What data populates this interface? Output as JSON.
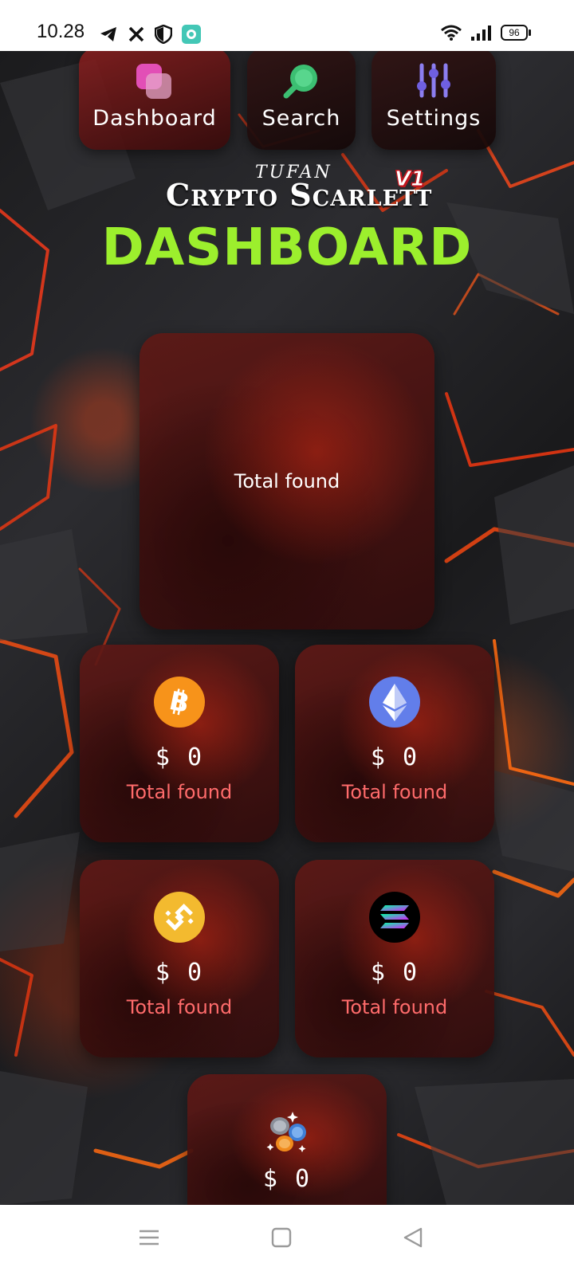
{
  "status_bar": {
    "time": "10.28",
    "battery": "96",
    "left_icons": [
      "telegram-icon",
      "x-icon",
      "shield-icon",
      "app-icon"
    ],
    "right_icons": [
      "wifi-icon",
      "signal-icon",
      "battery-icon"
    ]
  },
  "nav": {
    "dashboard_label": "Dashboard",
    "search_label": "Search",
    "settings_label": "Settings"
  },
  "brand": {
    "top": "TUFAN",
    "main": "Crypto Scarlett",
    "version": "V1"
  },
  "page_title": "DASHBOARD",
  "summary": {
    "label": "Total found"
  },
  "coins": [
    {
      "name": "bitcoin",
      "icon": "bitcoin-icon",
      "value": "$ 0",
      "label": "Total found",
      "color": "#f7931a"
    },
    {
      "name": "ethereum",
      "icon": "ethereum-icon",
      "value": "$ 0",
      "label": "Total found",
      "color": "#627eea"
    },
    {
      "name": "bnb",
      "icon": "bnb-icon",
      "value": "$ 0",
      "label": "Total found",
      "color": "#f3ba2f"
    },
    {
      "name": "solana",
      "icon": "solana-icon",
      "value": "$ 0",
      "label": "Total found",
      "color": "#000000"
    },
    {
      "name": "other",
      "icon": "coins-icon",
      "value": "$ 0"
    }
  ],
  "colors": {
    "title_green": "#9cef2d",
    "label_red": "#ff6b6b",
    "card_bg": "#5a1714"
  }
}
